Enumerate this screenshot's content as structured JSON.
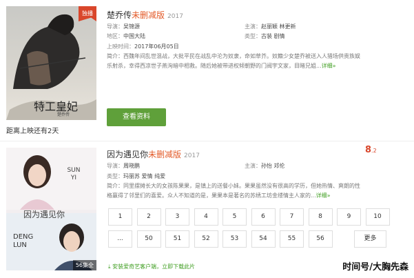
{
  "card1": {
    "tag": "独播",
    "poster_title": "特工皇妃",
    "poster_subtitle": "楚乔传",
    "countdown": "距离上映还有2天",
    "title": "楚乔传",
    "cut_label": "未删减版",
    "year": "2017",
    "director_label": "导演：",
    "director": "吴锦源",
    "starring_label": "主演：",
    "starring": "赵丽颖  林更新",
    "region_label": "地区：",
    "region": "中国大陆",
    "genre_label": "类型：",
    "genre": "古装  剧情",
    "release_label": "上映时间：",
    "release": "2017年06月05日",
    "intro_label": "简介：",
    "intro": "西魏年间乱世混战，大批平民在战乱中沦为奴隶，命如草芥。奴籍少女楚乔被送入人猎场供贵族娱乐射杀，幸得西凉世子燕洵暗中相救。随后她被带进权倾朝野的门阀宇文家，目睹兄姐...",
    "more": "详细»",
    "watch_button": "查看资料"
  },
  "card2": {
    "poster_name1": "SUN YI",
    "poster_name2": "DENG LUN",
    "poster_title": "因为遇见你",
    "episodes_badge": "56集全",
    "title": "因为遇见你",
    "cut_label": "未删减版",
    "year": "2017",
    "score_int": "8",
    "score_dec": ".2",
    "director_label": "导演：",
    "director": "周晓鹏",
    "starring_label": "主演：",
    "starring": "孙怡  邓伦",
    "genre_label": "类型：",
    "genre": "玛丽苏  爱情  纯爱",
    "intro_label": "简介：",
    "intro": "同里摆摊长大的女孩陈果果，是镇上的送餐小妹。果果虽然没有很高的学历，但她热情、爽朗的性格赢得了邻里们的喜爱。众人不知道的是，果果本是著名的苏绣工坊金缕情主人家的...",
    "more": "详细»",
    "episodes_row1": [
      "1",
      "2",
      "3",
      "4",
      "5",
      "6",
      "7",
      "8",
      "9",
      "10"
    ],
    "episodes_row2": [
      "...",
      "50",
      "51",
      "52",
      "53",
      "54",
      "55",
      "56"
    ],
    "more_episodes": "更多",
    "download": "安装爱奇艺客户端，立即下载此片"
  },
  "watermark": "时间号/大胸先森"
}
